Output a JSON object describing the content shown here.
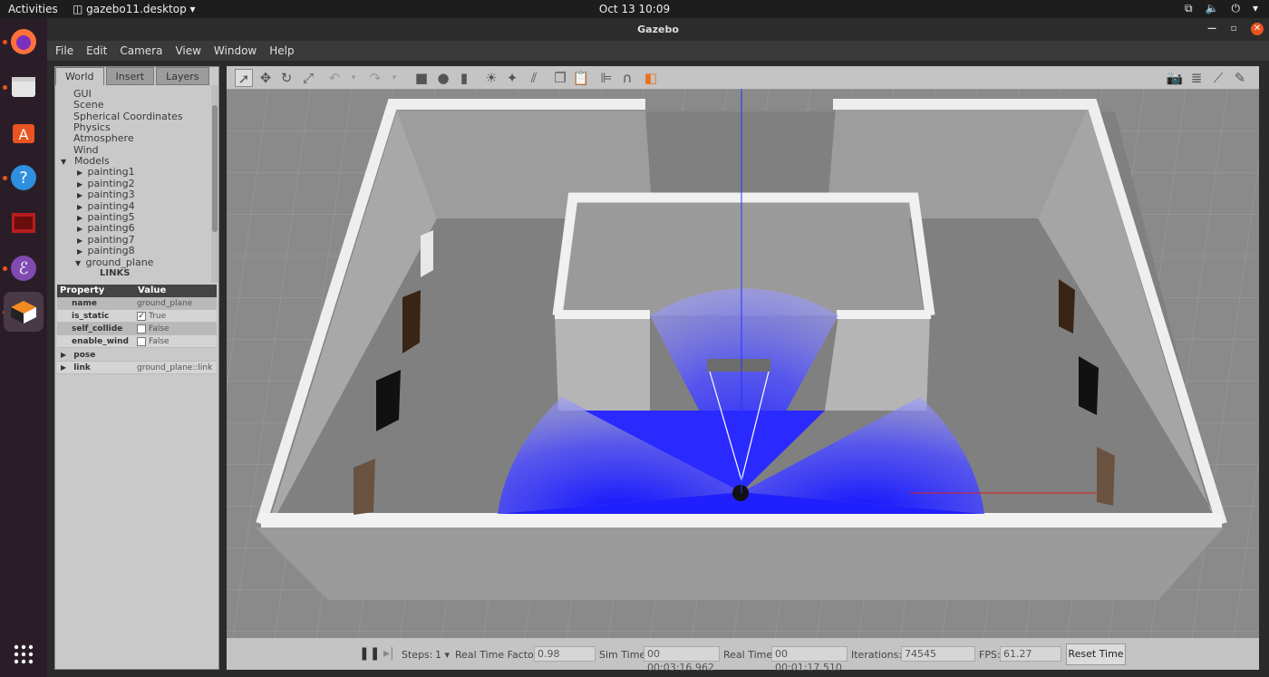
{
  "topbar": {
    "activities": "Activities",
    "app": "gazebo11.desktop",
    "clock": "Oct 13  10:09"
  },
  "window": {
    "title": "Gazebo"
  },
  "menu": [
    "File",
    "Edit",
    "Camera",
    "View",
    "Window",
    "Help"
  ],
  "tabs": [
    "World",
    "Insert",
    "Layers"
  ],
  "tree": {
    "items": [
      "GUI",
      "Scene",
      "Spherical Coordinates",
      "Physics",
      "Atmosphere",
      "Wind"
    ],
    "models_label": "Models",
    "models": [
      "painting1",
      "painting2",
      "painting3",
      "painting4",
      "painting5",
      "painting6",
      "painting7",
      "painting8",
      "ground_plane"
    ],
    "sub_label": "LINKS"
  },
  "properties": {
    "header": [
      "Property",
      "Value"
    ],
    "rows": [
      {
        "key": "name",
        "value": "ground_plane"
      },
      {
        "key": "is_static",
        "value": "True",
        "checked": true
      },
      {
        "key": "self_collide",
        "value": "False",
        "checked": false
      },
      {
        "key": "enable_wind",
        "value": "False",
        "checked": false
      }
    ],
    "groups": [
      {
        "key": "pose",
        "value": ""
      },
      {
        "key": "link",
        "value": "ground_plane::link"
      }
    ]
  },
  "bottom": {
    "steps_label": "Steps:",
    "steps_value": "1",
    "rtf_label": "Real Time Factor:",
    "rtf_value": "0.98",
    "sim_label": "Sim Time:",
    "sim_value": "00 00:03:16.962",
    "real_label": "Real Time:",
    "real_value": "00 00:01:17.510",
    "iter_label": "Iterations:",
    "iter_value": "74545",
    "fps_label": "FPS:",
    "fps_value": "61.27",
    "reset_label": "Reset Time"
  },
  "colors": {
    "laser": "#1a1aff",
    "ubuntu_orange": "#e95420"
  }
}
